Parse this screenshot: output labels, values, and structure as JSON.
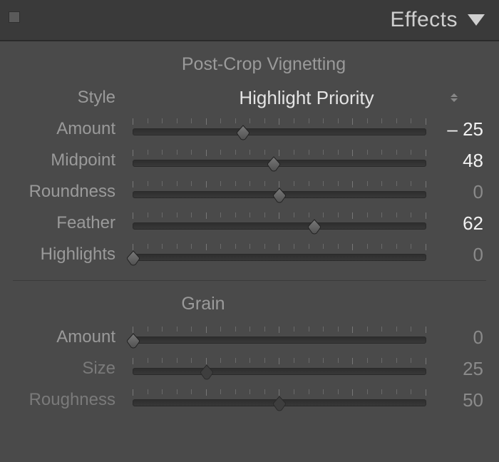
{
  "header": {
    "title": "Effects"
  },
  "vignette": {
    "title": "Post-Crop Vignetting",
    "style_label": "Style",
    "style_value": "Highlight Priority",
    "sliders": [
      {
        "label": "Amount",
        "value": -25,
        "display": "– 25",
        "min": -100,
        "max": 100,
        "active": true
      },
      {
        "label": "Midpoint",
        "value": 48,
        "display": "48",
        "min": 0,
        "max": 100,
        "active": true
      },
      {
        "label": "Roundness",
        "value": 0,
        "display": "0",
        "min": -100,
        "max": 100,
        "active": false
      },
      {
        "label": "Feather",
        "value": 62,
        "display": "62",
        "min": 0,
        "max": 100,
        "active": true
      },
      {
        "label": "Highlights",
        "value": 0,
        "display": "0",
        "min": 0,
        "max": 100,
        "active": false
      }
    ]
  },
  "grain": {
    "title": "Grain",
    "sliders": [
      {
        "label": "Amount",
        "value": 0,
        "display": "0",
        "min": 0,
        "max": 100,
        "active": false,
        "disabled": false
      },
      {
        "label": "Size",
        "value": 25,
        "display": "25",
        "min": 0,
        "max": 100,
        "active": false,
        "disabled": true
      },
      {
        "label": "Roughness",
        "value": 50,
        "display": "50",
        "min": 0,
        "max": 100,
        "active": false,
        "disabled": true
      }
    ]
  }
}
